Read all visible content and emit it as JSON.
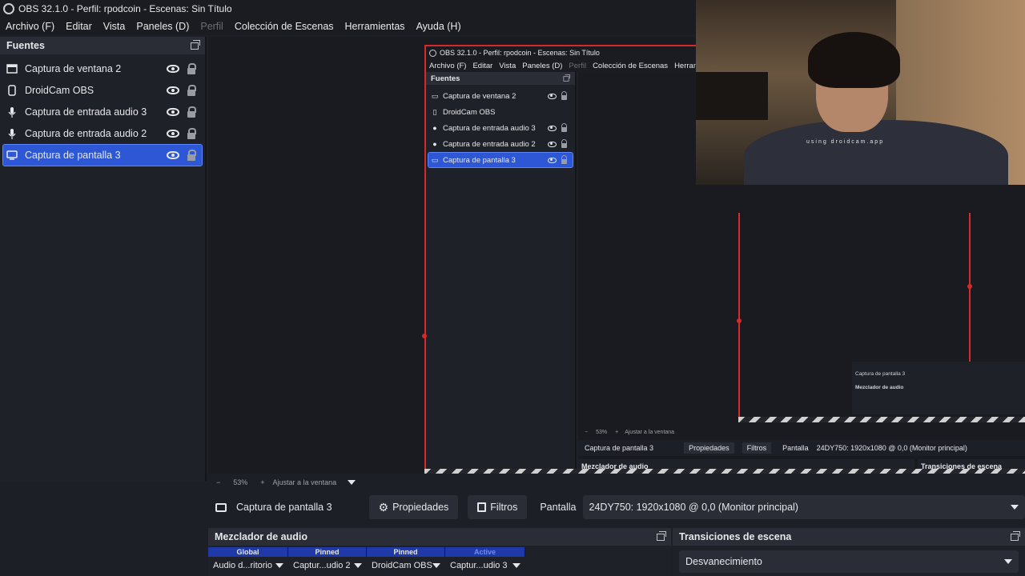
{
  "window": {
    "title": "OBS 32.1.0 - Perfil: rpodcoin - Escenas: Sin Título"
  },
  "menu": [
    "Archivo (F)",
    "Editar",
    "Vista",
    "Paneles (D)",
    "Perfil",
    "Colección de Escenas",
    "Herramientas",
    "Ayuda (H)"
  ],
  "sources": {
    "title": "Fuentes",
    "items": [
      {
        "label": "Captura de ventana 2",
        "icon": "window-icon"
      },
      {
        "label": "DroidCam OBS",
        "icon": "phone-icon"
      },
      {
        "label": "Captura de entrada audio 3",
        "icon": "microphone-icon"
      },
      {
        "label": "Captura de entrada audio 2",
        "icon": "microphone-icon"
      },
      {
        "label": "Captura de pantalla 3",
        "icon": "monitor-icon",
        "selected": true
      }
    ]
  },
  "nested": {
    "title": "OBS 32.1.0 - Perfil: rpodcoin - Escenas: Sin Título",
    "menu": [
      "Archivo (F)",
      "Editar",
      "Vista",
      "Paneles (D)",
      "Perfil",
      "Colección de Escenas",
      "Herramie"
    ],
    "sources_title": "Fuentes",
    "items": [
      "Captura de ventana 2",
      "DroidCam OBS",
      "Captura de entrada audio 3",
      "Captura de entrada audio 2",
      "Captura de pantalla 3"
    ],
    "zoom": "53%",
    "fit": "Ajustar a la ventana",
    "ctx_source": "Captura de pantalla 3",
    "ctx_props": "Propiedades",
    "ctx_filters": "Filtros",
    "ctx_screen": "Pantalla",
    "ctx_monitor": "24DY750: 1920x1080 @ 0,0 (Monitor principal)",
    "mixer_title": "Mezclador de audio",
    "trans_title": "Transiciones de escena",
    "trans_value": "Desvanecimiento"
  },
  "webcam": {
    "watermark": "using droidcam.app"
  },
  "zoombar": {
    "zoom": "53%",
    "fit": "Ajustar a la ventana"
  },
  "context": {
    "source": "Captura de pantalla 3",
    "properties": "Propiedades",
    "filters": "Filtros",
    "screen_label": "Pantalla",
    "monitor": "24DY750: 1920x1080 @ 0,0 (Monitor principal)"
  },
  "mixer": {
    "title": "Mezclador de audio",
    "tabs": [
      "Global",
      "Pinned",
      "Pinned",
      "Active"
    ],
    "channels": [
      "Audio d...ritorio",
      "Captur...udio 2",
      "DroidCam OBS",
      "Captur...udio 3"
    ]
  },
  "transitions": {
    "title": "Transiciones de escena",
    "value": "Desvanecimiento"
  },
  "colors": {
    "accent": "#2e57d6",
    "selection_outline": "#5e86ff",
    "preview_border": "#d62a2a"
  }
}
